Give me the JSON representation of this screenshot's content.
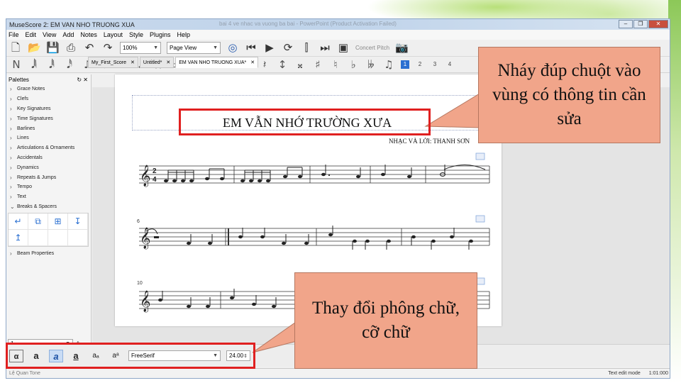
{
  "app": {
    "title": "MuseScore 2: EM VAN NHO TRUONG XUA",
    "background_title": "bai 4 ve nhac va vuong ba bai - PowerPoint (Product Activation Failed)",
    "window_buttons": [
      "–",
      "❐",
      "✕"
    ]
  },
  "menu": {
    "items": [
      "File",
      "Edit",
      "View",
      "Add",
      "Notes",
      "Layout",
      "Style",
      "Plugins",
      "Help"
    ]
  },
  "toolbar": {
    "zoom": "100%",
    "view_mode": "Page View",
    "concert_pitch": "Concert Pitch",
    "voices": [
      "1",
      "2",
      "3",
      "4"
    ]
  },
  "palettes": {
    "header": "Palettes",
    "items": [
      "Grace Notes",
      "Clefs",
      "Key Signatures",
      "Time Signatures",
      "Barlines",
      "Lines",
      "Articulations & Ornaments",
      "Accidentals",
      "Dynamics",
      "Repeats & Jumps",
      "Tempo",
      "Text",
      "Breaks & Spacers"
    ],
    "after_grid": "Beam Properties",
    "workspace": "1",
    "add": "+"
  },
  "tabs": [
    {
      "label": "My_First_Score",
      "close": "✕"
    },
    {
      "label": "Untitled*",
      "close": "✕"
    },
    {
      "label": "EM VAN NHO TRUONG XUA*",
      "close": "✕"
    }
  ],
  "score": {
    "title": "EM VẪN NHỚ TRƯỜNG XƯA",
    "composer": "NHẠC VÀ LỜI: THANH SƠN",
    "measure_numbers": [
      "6",
      "10"
    ]
  },
  "text_toolbar": {
    "font": "FreeSerif",
    "size": "24.00"
  },
  "status": {
    "mode": "Text edit mode",
    "time": "1:01:000",
    "left": "Lệ Quan Tone"
  },
  "callouts": {
    "top": "Nháy đúp chuột vào vùng có thông tin cần sửa",
    "bottom": "Thay đổi phông chữ, cỡ chữ"
  },
  "colors": {
    "callout_fill": "#f1a58a",
    "highlight": "#e02020",
    "accent": "#2a6fd1"
  }
}
